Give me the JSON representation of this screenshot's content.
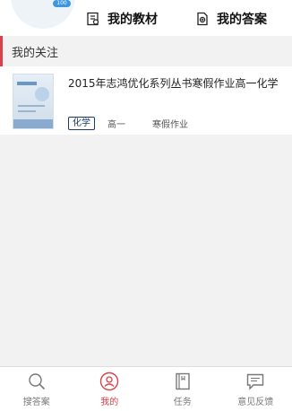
{
  "header": {
    "avatar_badge": "100",
    "links": [
      {
        "label": "我的教材",
        "icon": "textbook-icon"
      },
      {
        "label": "我的答案",
        "icon": "answer-icon"
      }
    ]
  },
  "section": {
    "title": "我的关注",
    "accent_color": "#d8404a"
  },
  "book": {
    "title": "2015年志鸿优化系列丛书寒假作业高一化学",
    "subject": "化学",
    "grade": "高一",
    "type": "寒假作业"
  },
  "nav": {
    "active_color": "#d8404a",
    "items": [
      {
        "label": "搜答案",
        "icon": "search-icon",
        "active": false
      },
      {
        "label": "我的",
        "icon": "user-icon",
        "active": true
      },
      {
        "label": "任务",
        "icon": "task-icon",
        "active": false
      },
      {
        "label": "意见反馈",
        "icon": "feedback-icon",
        "active": false
      }
    ]
  }
}
